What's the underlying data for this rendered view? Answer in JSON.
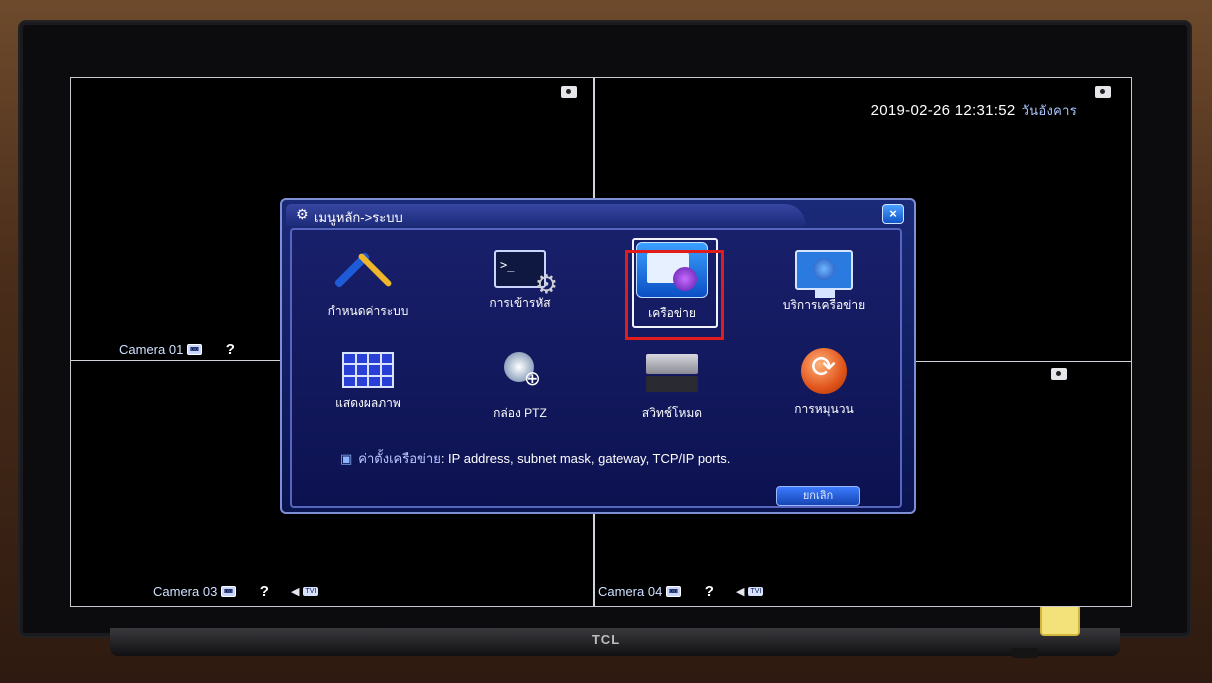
{
  "osd": {
    "datetime": "2019-02-26 12:31:52",
    "weekday": "วันอังคาร"
  },
  "cameras": [
    {
      "label": "Camera 01",
      "rec_badge": "◙◙",
      "status": "?"
    },
    {
      "label": "Camera 03",
      "rec_badge": "◙◙",
      "status": "?",
      "speaker": "◀",
      "type": "TVI"
    },
    {
      "label": "Camera 04",
      "rec_badge": "◙◙",
      "status": "?",
      "speaker": "◀",
      "type": "TVI"
    }
  ],
  "dialog": {
    "title": "เมนูหลัก->ระบบ",
    "close_label": "×",
    "items": [
      {
        "label": "กำหนดค่าระบบ",
        "icon": "tools-icon"
      },
      {
        "label": "การเข้ารหัส",
        "icon": "terminal-gear-icon"
      },
      {
        "label": "เครือข่าย",
        "icon": "network-icon",
        "selected": true
      },
      {
        "label": "บริการเครือข่าย",
        "icon": "globe-monitor-icon"
      },
      {
        "label": "แสดงผลภาพ",
        "icon": "display-grid-icon"
      },
      {
        "label": "กล่อง PTZ",
        "icon": "ptz-camera-icon"
      },
      {
        "label": "สวิทช์โหมด",
        "icon": "switch-mode-icon"
      },
      {
        "label": "การหมุนวน",
        "icon": "cycle-icon"
      }
    ],
    "hint": {
      "key": "ค่าตั้งเครือข่าย",
      "text": ": IP address, subnet mask, gateway, TCP/IP ports."
    },
    "cancel_label": "ยกเลิก"
  },
  "tv": {
    "brand": "TCL"
  },
  "colors": {
    "highlight": "#e21b1b",
    "dialog_bg": "#1b2a78",
    "osd_text": "#ffffff"
  }
}
